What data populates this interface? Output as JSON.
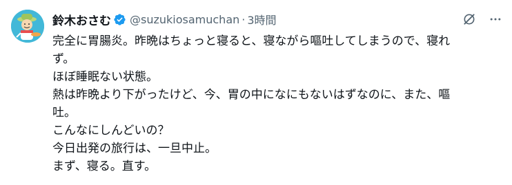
{
  "tweet": {
    "author": {
      "display_name": "鈴木おさむ",
      "handle": "@suzukiosamuchan",
      "verified_icon": "verified-badge-icon",
      "avatar_icon": "avatar-illustration"
    },
    "separator": "·",
    "time": "3時間",
    "actions": {
      "grok_icon": "grok-icon",
      "more_icon": "more-horizontal-icon"
    },
    "lines": [
      "完全に胃腸炎。昨晩はちょっと寝ると、寝ながら嘔吐してしまうので、寝れ",
      "ず。",
      "ほぼ睡眠ない状態。",
      "熱は昨晩より下がったけど、今、胃の中になにもないはずなのに、また、嘔",
      "吐。",
      "こんなにしんどいの？",
      "今日出発の旅行は、一旦中止。",
      "まず、寝る。直す。"
    ]
  },
  "colors": {
    "text_primary": "#0f1419",
    "text_secondary": "#536471",
    "verified": "#1d9bf0",
    "avatar_bg": "#42b8d8"
  }
}
